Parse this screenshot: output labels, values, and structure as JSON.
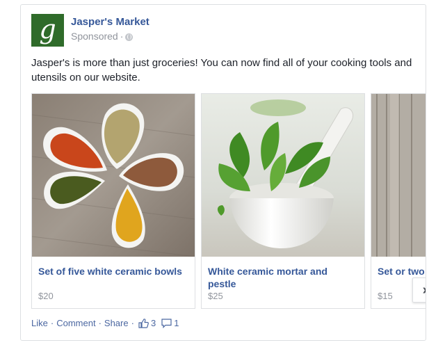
{
  "post": {
    "page_name": "Jasper's Market",
    "logo_letter": "g",
    "sponsored_label": "Sponsored",
    "meta_dot": "·",
    "text": "Jasper's is more than just groceries! You can now find all of your cooking tools and utensils on our website."
  },
  "carousel": {
    "items": [
      {
        "title": "Set of five white ceramic bowls",
        "price": "$20"
      },
      {
        "title": "White ceramic mortar and pestle",
        "price": "$25"
      },
      {
        "title": "Set or two utensils",
        "price": "$15"
      }
    ],
    "next_icon": "chevron-right-icon"
  },
  "actions": {
    "like": "Like",
    "comment": "Comment",
    "share": "Share",
    "dot": "·",
    "like_count": "3",
    "comment_count": "1"
  },
  "colors": {
    "link_blue": "#365899",
    "logo_green": "#2f6b2a",
    "muted": "#90949c"
  }
}
